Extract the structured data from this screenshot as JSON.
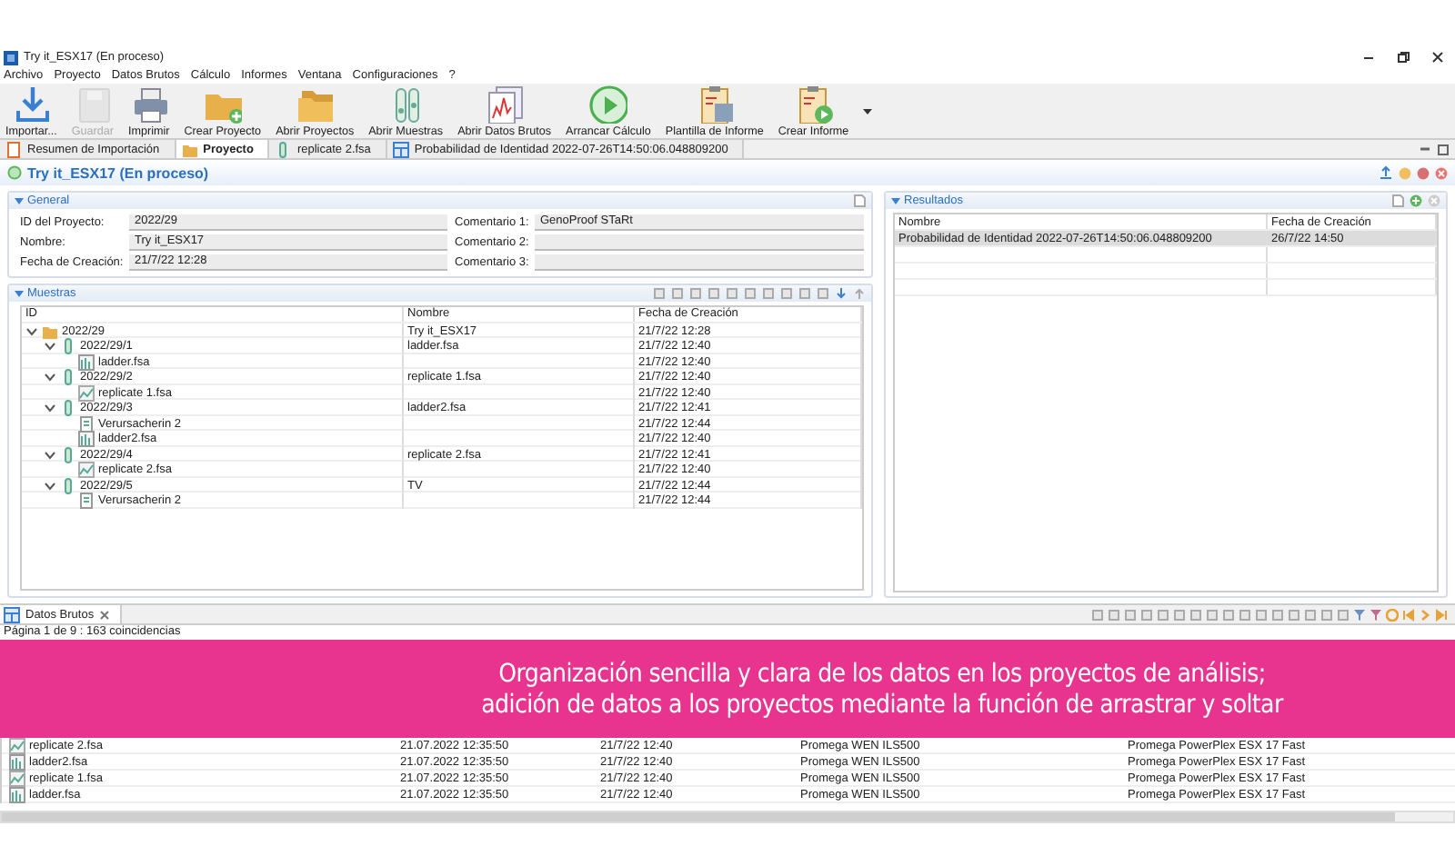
{
  "window": {
    "title": "Try it_ESX17 (En proceso)"
  },
  "menu": [
    "Archivo",
    "Proyecto",
    "Datos Brutos",
    "Cálculo",
    "Informes",
    "Ventana",
    "Configuraciones",
    "?"
  ],
  "toolbar": [
    {
      "label": "Importar...",
      "disabled": false
    },
    {
      "label": "Guardar",
      "disabled": true
    },
    {
      "label": "Imprimir",
      "disabled": false
    },
    {
      "label": "Crear Proyecto",
      "disabled": false
    },
    {
      "label": "Abrir Proyectos",
      "disabled": false
    },
    {
      "label": "Abrir Muestras",
      "disabled": false
    },
    {
      "label": "Abrir Datos Brutos",
      "disabled": false
    },
    {
      "label": "Arrancar Cálculo",
      "disabled": false
    },
    {
      "label": "Plantilla de Informe",
      "disabled": false
    },
    {
      "label": "Crear Informe",
      "disabled": false
    }
  ],
  "tabs": [
    {
      "label": "Resumen de Importación",
      "selected": false
    },
    {
      "label": "Proyecto",
      "selected": true
    },
    {
      "label": "replicate 2.fsa",
      "selected": false
    },
    {
      "label": "Probabilidad de Identidad 2022-07-26T14:50:06.048809200",
      "selected": false
    }
  ],
  "project_header": {
    "title": "Try it_ESX17 (En proceso)"
  },
  "general": {
    "title": "General",
    "expanded": true,
    "fields": [
      {
        "label": "ID del Proyecto:",
        "value": "2022/29"
      },
      {
        "label": "Nombre:",
        "value": "Try it_ESX17"
      },
      {
        "label": "Fecha de Creación:",
        "value": "21/7/22 12:28"
      }
    ],
    "comments": [
      {
        "label": "Comentario 1:",
        "value": "GenoProof STaRt"
      },
      {
        "label": "Comentario 2:"
      },
      {
        "label": "Comentario 3:"
      }
    ]
  },
  "muestras": {
    "title": "Muestras",
    "expanded": true,
    "columns": [
      "ID",
      "Nombre",
      "Fecha de Creación"
    ],
    "rows": [
      {
        "kind": "project",
        "id": "2022/29",
        "name": "Try it_ESX17",
        "date": "21/7/22 12:28",
        "expanded": true,
        "children": [
          {
            "kind": "sample",
            "id": "2022/29/1",
            "name": "ladder.fsa",
            "date": "21/7/22 12:40",
            "expanded": true,
            "children": [
              {
                "kind": "ladder",
                "id": "ladder.fsa",
                "date": "21/7/22 12:40"
              }
            ]
          },
          {
            "kind": "sample",
            "id": "2022/29/2",
            "name": "replicate 1.fsa",
            "date": "21/7/22 12:40",
            "expanded": true,
            "children": [
              {
                "kind": "trace",
                "id": "replicate 1.fsa",
                "date": "21/7/22 12:40"
              }
            ]
          },
          {
            "kind": "sample",
            "id": "2022/29/3",
            "name": "ladder2.fsa",
            "date": "21/7/22 12:41",
            "expanded": true,
            "children": [
              {
                "kind": "profile",
                "id": "Verursacherin 2",
                "date": "21/7/22 12:44"
              },
              {
                "kind": "ladder",
                "id": "ladder2.fsa",
                "date": "21/7/22 12:40"
              }
            ]
          },
          {
            "kind": "sample",
            "id": "2022/29/4",
            "name": "replicate 2.fsa",
            "date": "21/7/22 12:41",
            "expanded": true,
            "children": [
              {
                "kind": "trace",
                "id": "replicate 2.fsa",
                "date": "21/7/22 12:40"
              }
            ]
          },
          {
            "kind": "sample",
            "id": "2022/29/5",
            "name": "TV",
            "date": "21/7/22 12:44",
            "expanded": true,
            "children": [
              {
                "kind": "profile",
                "id": "Verursacherin 2",
                "date": "21/7/22 12:44"
              }
            ]
          }
        ]
      }
    ]
  },
  "resultados": {
    "title": "Resultados",
    "expanded": true,
    "columns": [
      "Nombre",
      "Fecha de Creación"
    ],
    "rows": [
      {
        "cells": [
          "Probabilidad de Identidad 2022-07-26T14:50:06.048809200",
          "26/7/22 14:50"
        ],
        "selected": true
      }
    ]
  },
  "raw_data": {
    "title": "Datos Brutos",
    "pager": "Página 1 de 9 : 163 coincidencias",
    "rows": [
      {
        "kind": "trace",
        "cells": [
          "replicate 2.fsa",
          "21.07.2022 12:35:50",
          "21/7/22 12:40",
          "Promega WEN ILS500",
          "Promega PowerPlex ESX 17 Fast"
        ]
      },
      {
        "kind": "ladder",
        "cells": [
          "ladder2.fsa",
          "21.07.2022 12:35:50",
          "21/7/22 12:40",
          "Promega WEN ILS500",
          "Promega PowerPlex ESX 17 Fast"
        ]
      },
      {
        "kind": "trace",
        "cells": [
          "replicate 1.fsa",
          "21.07.2022 12:35:50",
          "21/7/22 12:40",
          "Promega WEN ILS500",
          "Promega PowerPlex ESX 17 Fast"
        ]
      },
      {
        "kind": "ladder",
        "cells": [
          "ladder.fsa",
          "21.07.2022 12:35:50",
          "21/7/22 12:40",
          "Promega WEN ILS500",
          "Promega PowerPlex ESX 17 Fast"
        ]
      }
    ]
  },
  "banner": {
    "lines": [
      "Organización sencilla y clara de los datos en los proyectos de análisis;",
      "adición de datos a los proyectos mediante la función de arrastrar y soltar"
    ]
  }
}
